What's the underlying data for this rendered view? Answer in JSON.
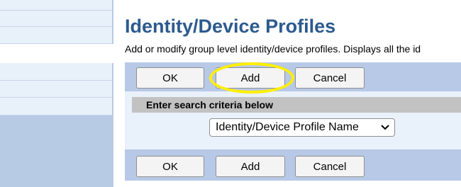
{
  "page": {
    "title": "Identity/Device Profiles",
    "description": "Add or modify group level identity/device profiles. Displays all the id"
  },
  "toolbar_top": {
    "ok_label": "OK",
    "add_label": "Add",
    "cancel_label": "Cancel"
  },
  "search": {
    "header": "Enter search criteria below",
    "field_selected": "Identity/Device Profile Name"
  },
  "toolbar_bottom": {
    "ok_label": "OK",
    "add_label": "Add",
    "cancel_label": "Cancel"
  },
  "colors": {
    "title": "#2c5a8f",
    "button_bar": "#b7c9e6",
    "sidebar": "#b8cbe5",
    "search_panel": "#e9f1fb",
    "search_header": "#c2c2c2",
    "highlight": "#ffee00"
  },
  "icons": {
    "dropdown": "chevron-down-icon"
  }
}
